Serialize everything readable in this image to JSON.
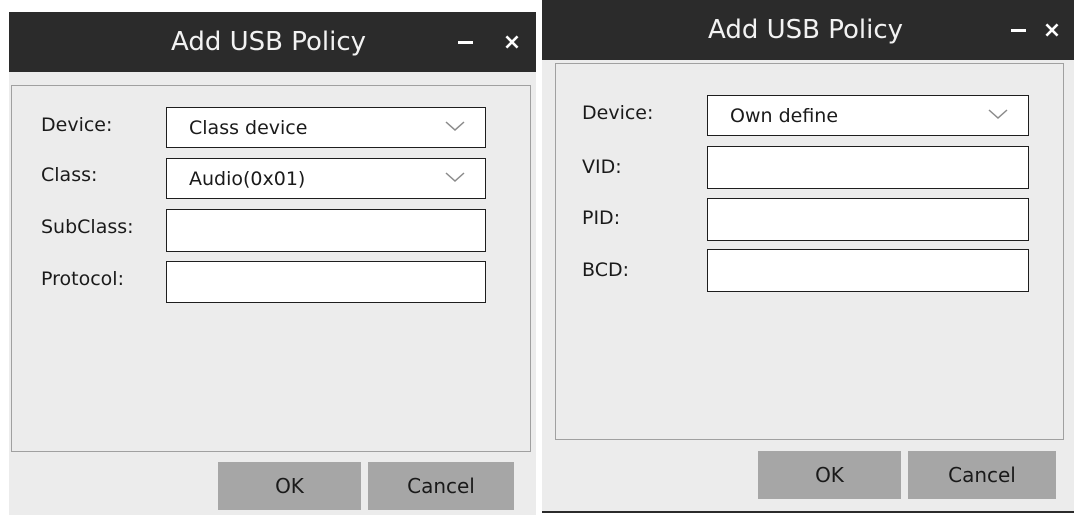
{
  "left_dialog": {
    "title": "Add USB Policy",
    "minimize_icon": "minus-icon",
    "close_label": "×",
    "device": {
      "label": "Device:",
      "value": "Class device"
    },
    "class": {
      "label": "Class:",
      "value": "Audio(0x01)"
    },
    "subclass": {
      "label": "SubClass:",
      "value": ""
    },
    "protocol": {
      "label": "Protocol:",
      "value": ""
    },
    "ok_label": "OK",
    "cancel_label": "Cancel"
  },
  "right_dialog": {
    "title": "Add USB Policy",
    "minimize_icon": "minus-icon",
    "close_label": "×",
    "device": {
      "label": "Device:",
      "value": "Own define"
    },
    "vid": {
      "label": "VID:",
      "value": ""
    },
    "pid": {
      "label": "PID:",
      "value": ""
    },
    "bcd": {
      "label": "BCD:",
      "value": ""
    },
    "ok_label": "OK",
    "cancel_label": "Cancel"
  },
  "colors": {
    "titlebar": "#2b2b2b",
    "dialog_background": "#ececec",
    "button": "#a6a6a6",
    "field_border": "#1e1e1e"
  }
}
